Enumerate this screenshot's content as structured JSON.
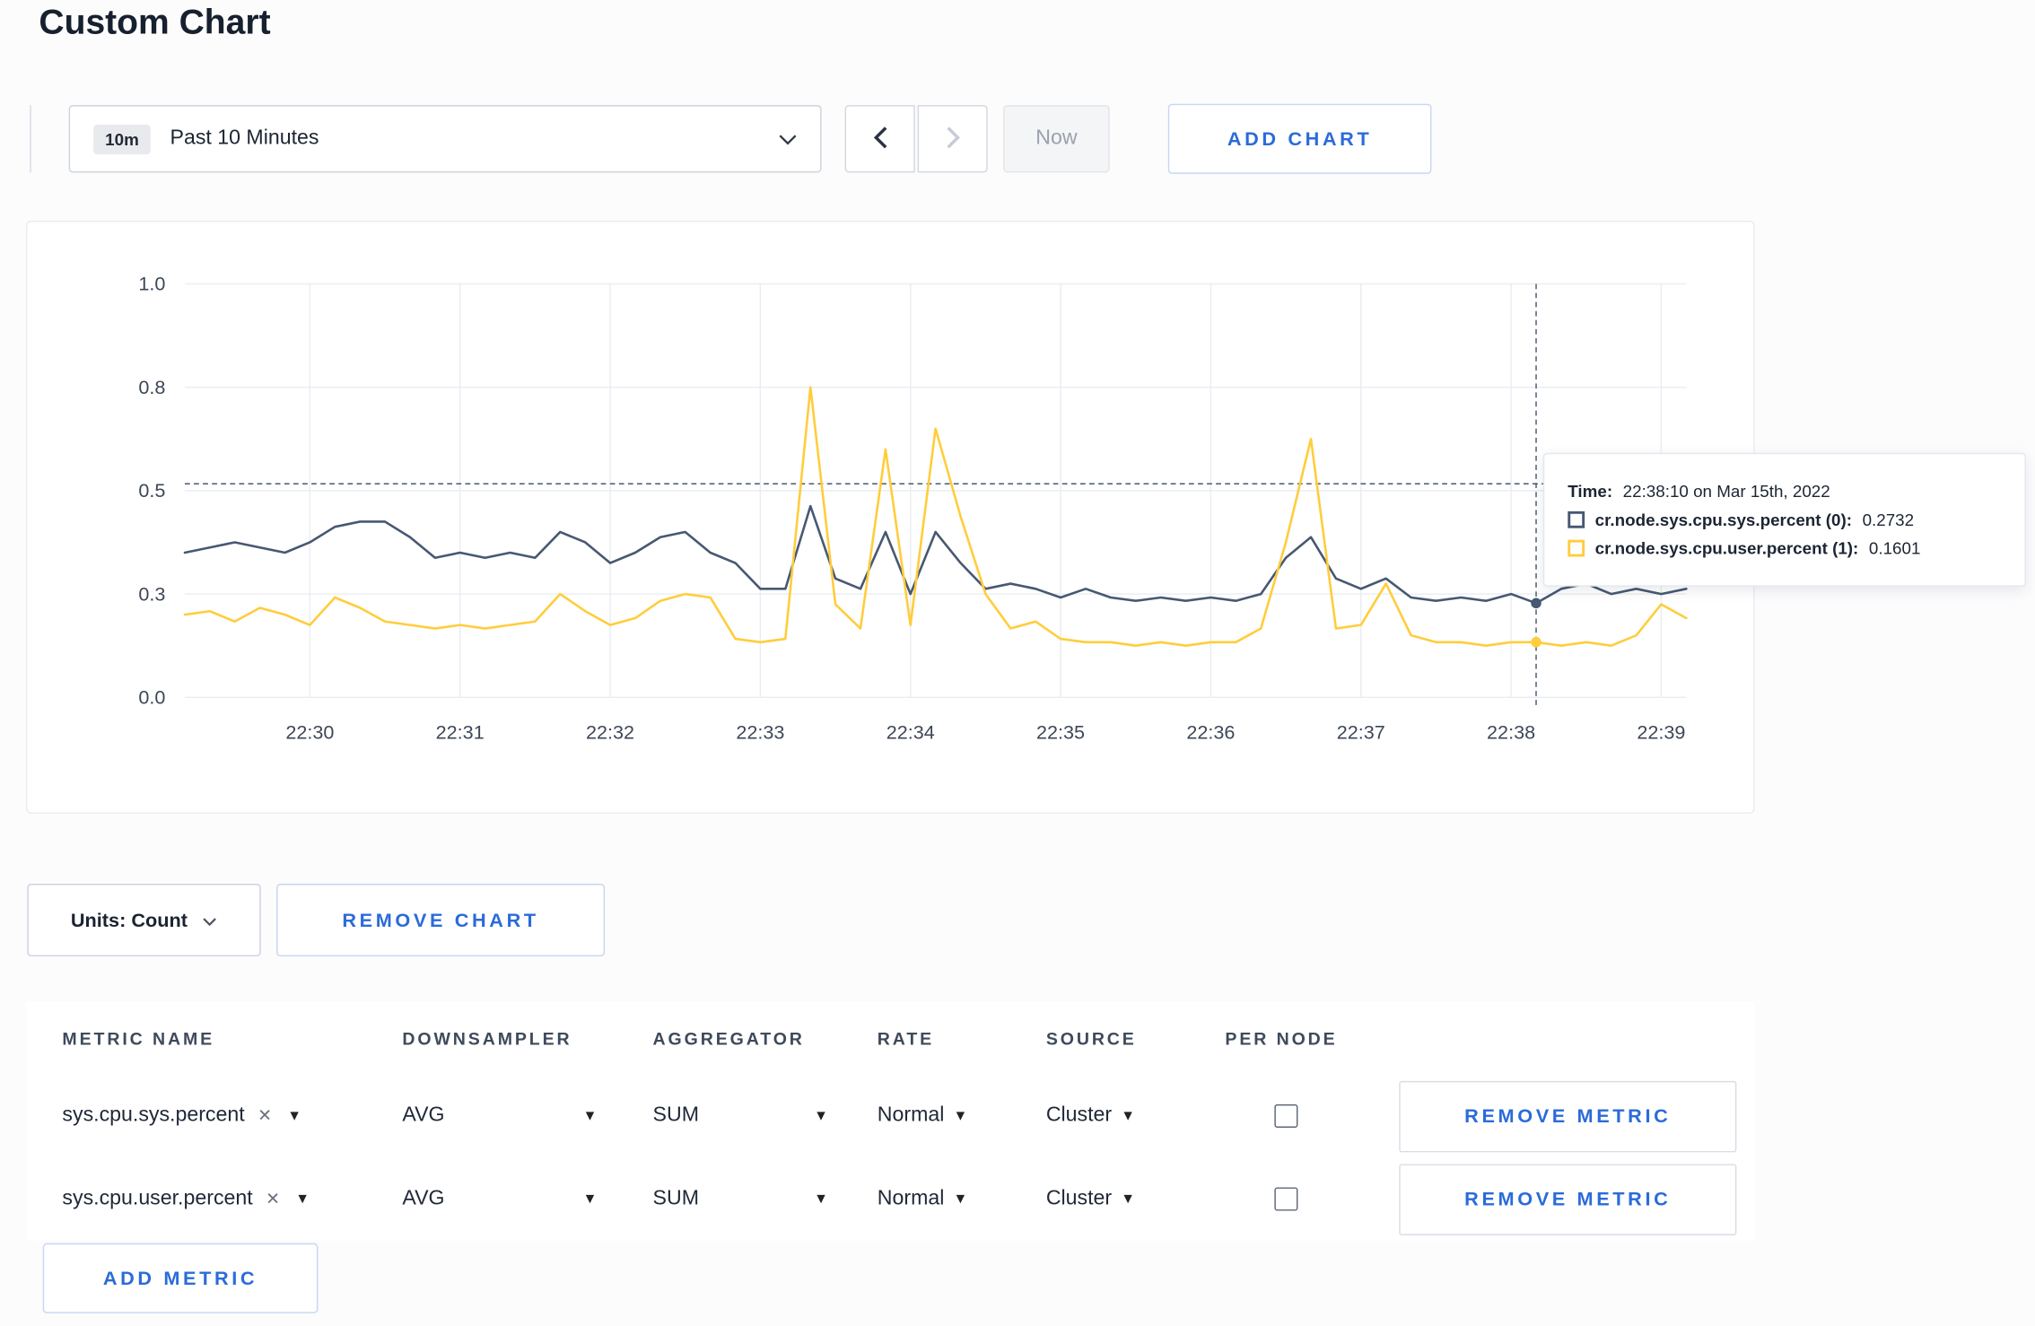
{
  "page": {
    "title": "Custom Chart"
  },
  "toolbar": {
    "range_badge": "10m",
    "range_label": "Past 10 Minutes",
    "now_label": "Now",
    "add_chart_label": "ADD CHART"
  },
  "chart": {
    "tooltip": {
      "time_label": "Time:",
      "time_value": "22:38:10 on Mar 15th, 2022",
      "series": [
        {
          "label": "cr.node.sys.cpu.sys.percent (0):",
          "value": "0.2732",
          "color": "#475872"
        },
        {
          "label": "cr.node.sys.cpu.user.percent (1):",
          "value": "0.1601",
          "color": "#ffcd3c"
        }
      ]
    }
  },
  "chart_data": {
    "type": "line",
    "title": "",
    "xlabel": "",
    "ylabel": "",
    "grid": true,
    "legend": "none",
    "y_tick_values": [
      0,
      0.3,
      0.5,
      0.8,
      1.0
    ],
    "y_tick_labels": [
      "0.0",
      "0.3",
      "0.5",
      "0.8",
      "1.0"
    ],
    "x_tick_labels": [
      "22:30",
      "22:31",
      "22:32",
      "22:33",
      "22:34",
      "22:35",
      "22:36",
      "22:37",
      "22:38",
      "22:39"
    ],
    "x_tick_fractions": [
      0.0833,
      0.1833,
      0.2833,
      0.3833,
      0.4833,
      0.5833,
      0.6833,
      0.7833,
      0.8833,
      0.9833
    ],
    "x_domain": [
      "22:29:10",
      "22:39:10"
    ],
    "hover_index": 54,
    "hover_time": "22:38:10",
    "guide_line_value": 0.52,
    "series": [
      {
        "name": "cr.node.sys.cpu.sys.percent",
        "color": "#475872",
        "hover_value": 0.2732,
        "values": [
          0.38,
          0.39,
          0.4,
          0.39,
          0.38,
          0.4,
          0.43,
          0.44,
          0.44,
          0.41,
          0.37,
          0.38,
          0.37,
          0.38,
          0.37,
          0.42,
          0.4,
          0.36,
          0.38,
          0.41,
          0.42,
          0.38,
          0.36,
          0.31,
          0.31,
          0.47,
          0.33,
          0.31,
          0.42,
          0.3,
          0.42,
          0.36,
          0.31,
          0.32,
          0.31,
          0.29,
          0.31,
          0.29,
          0.28,
          0.29,
          0.28,
          0.29,
          0.28,
          0.3,
          0.37,
          0.41,
          0.33,
          0.31,
          0.33,
          0.29,
          0.28,
          0.29,
          0.28,
          0.3,
          0.2732,
          0.31,
          0.32,
          0.3,
          0.31,
          0.3,
          0.31
        ]
      },
      {
        "name": "cr.node.sys.cpu.user.percent",
        "color": "#ffcd3c",
        "hover_value": 0.1601,
        "values": [
          0.24,
          0.25,
          0.22,
          0.26,
          0.24,
          0.21,
          0.29,
          0.26,
          0.22,
          0.21,
          0.2,
          0.21,
          0.2,
          0.21,
          0.22,
          0.3,
          0.25,
          0.21,
          0.23,
          0.28,
          0.3,
          0.29,
          0.17,
          0.16,
          0.17,
          0.8,
          0.27,
          0.2,
          0.62,
          0.21,
          0.68,
          0.45,
          0.3,
          0.2,
          0.22,
          0.17,
          0.16,
          0.16,
          0.15,
          0.16,
          0.15,
          0.16,
          0.16,
          0.2,
          0.4,
          0.65,
          0.2,
          0.21,
          0.32,
          0.18,
          0.16,
          0.16,
          0.15,
          0.16,
          0.1601,
          0.15,
          0.16,
          0.15,
          0.18,
          0.27,
          0.23
        ]
      }
    ]
  },
  "chart_footer": {
    "units_label": "Units: Count",
    "remove_chart_label": "REMOVE CHART"
  },
  "metrics_table": {
    "headers": [
      "METRIC NAME",
      "DOWNSAMPLER",
      "AGGREGATOR",
      "RATE",
      "SOURCE",
      "PER NODE"
    ],
    "rows": [
      {
        "metric": "sys.cpu.sys.percent",
        "downsampler": "AVG",
        "aggregator": "SUM",
        "rate": "Normal",
        "source": "Cluster",
        "per_node": false,
        "remove_label": "REMOVE METRIC"
      },
      {
        "metric": "sys.cpu.user.percent",
        "downsampler": "AVG",
        "aggregator": "SUM",
        "rate": "Normal",
        "source": "Cluster",
        "per_node": false,
        "remove_label": "REMOVE METRIC"
      }
    ],
    "add_metric_label": "ADD METRIC"
  }
}
